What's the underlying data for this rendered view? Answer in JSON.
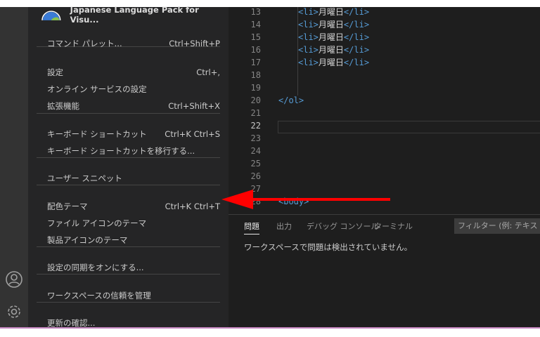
{
  "menu": {
    "extension_title": "Japanese Language Pack for Visu...",
    "items": [
      {
        "label": "コマンド パレット...",
        "shortcut": "Ctrl+Shift+P"
      },
      {
        "label": "設定",
        "shortcut": "Ctrl+,"
      },
      {
        "label": "オンライン サービスの設定",
        "shortcut": ""
      },
      {
        "label": "拡張機能",
        "shortcut": "Ctrl+Shift+X"
      },
      {
        "label": "キーボード ショートカット",
        "shortcut": "Ctrl+K Ctrl+S"
      },
      {
        "label": "キーボード ショートカットを移行する...",
        "shortcut": ""
      },
      {
        "label": "ユーザー スニペット",
        "shortcut": ""
      },
      {
        "label": "配色テーマ",
        "shortcut": "Ctrl+K Ctrl+T"
      },
      {
        "label": "ファイル アイコンのテーマ",
        "shortcut": ""
      },
      {
        "label": "製品アイコンのテーマ",
        "shortcut": ""
      },
      {
        "label": "設定の同期をオンにする...",
        "shortcut": ""
      },
      {
        "label": "ワークスペースの信頼を管理",
        "shortcut": ""
      },
      {
        "label": "更新の確認...",
        "shortcut": ""
      }
    ]
  },
  "editor": {
    "lines": [
      {
        "n": "13",
        "open": "<li>",
        "text": "月曜日",
        "close": "</li>"
      },
      {
        "n": "14",
        "open": "<li>",
        "text": "月曜日",
        "close": "</li>"
      },
      {
        "n": "15",
        "open": "<li>",
        "text": "月曜日",
        "close": "</li>"
      },
      {
        "n": "16",
        "open": "<li>",
        "text": "月曜日",
        "close": "</li>"
      },
      {
        "n": "17",
        "open": "<li>",
        "text": "月曜日",
        "close": "</li>"
      },
      {
        "n": "18"
      },
      {
        "n": "19"
      },
      {
        "n": "20",
        "open": "</ol>",
        "flush": true
      },
      {
        "n": "21"
      },
      {
        "n": "22"
      },
      {
        "n": "23"
      },
      {
        "n": "24"
      },
      {
        "n": "25"
      },
      {
        "n": "26"
      },
      {
        "n": "27"
      },
      {
        "n": "28",
        "open": "<body>",
        "flush": true
      }
    ]
  },
  "panel": {
    "tabs": [
      "問題",
      "出力",
      "デバッグ コンソール",
      "ターミナル"
    ],
    "filter_placeholder": "フィルター (例: テキスト、**",
    "message": "ワークスペースで問題は検出されていません。"
  },
  "colors": {
    "accent_arrow": "#ff0000",
    "status_bar": "#c586c0"
  }
}
